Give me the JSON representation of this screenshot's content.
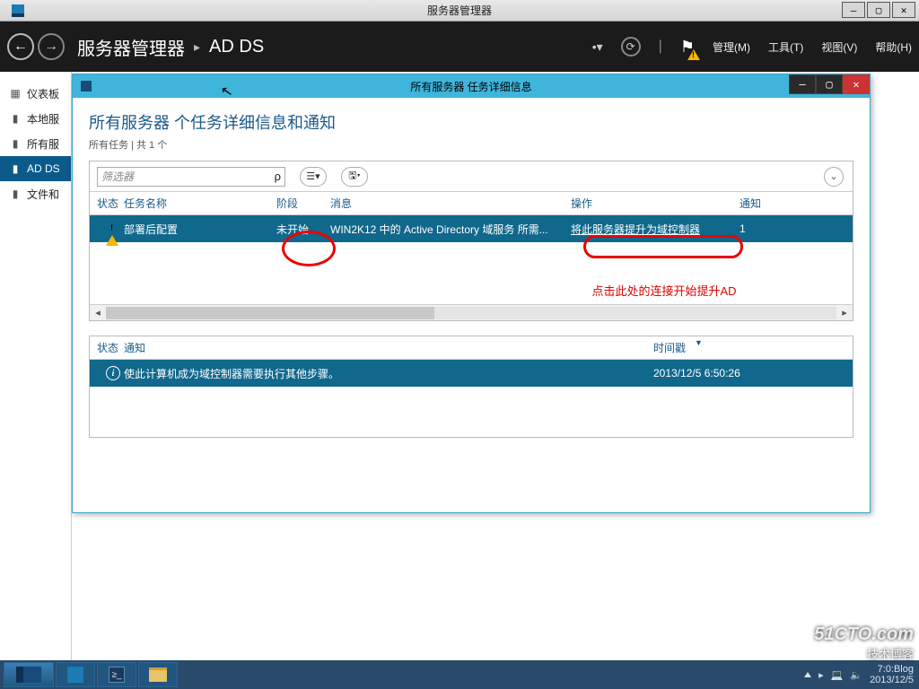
{
  "outer_window": {
    "title": "服务器管理器"
  },
  "header": {
    "breadcrumb_root": "服务器管理器",
    "breadcrumb_leaf": "AD DS",
    "menu_manage": "管理(M)",
    "menu_tools": "工具(T)",
    "menu_view": "视图(V)",
    "menu_help": "帮助(H)"
  },
  "sidebar": {
    "items": [
      {
        "icon": "▦",
        "label": "仪表板"
      },
      {
        "icon": "▮",
        "label": "本地服"
      },
      {
        "icon": "▮",
        "label": "所有服"
      },
      {
        "icon": "▮",
        "label": "AD DS"
      },
      {
        "icon": "▮",
        "label": "文件和"
      }
    ]
  },
  "dialog": {
    "title": "所有服务器 任务详细信息",
    "heading": "所有服务器 个任务详细信息和通知",
    "subcount": "所有任务 | 共 1 个",
    "filter_placeholder": "筛选器",
    "columns": {
      "status": "状态",
      "name": "任务名称",
      "stage": "阶段",
      "message": "消息",
      "action": "操作",
      "notify": "通知"
    },
    "row": {
      "name": "部署后配置",
      "stage": "未开始",
      "message": "WIN2K12 中的 Active Directory 域服务 所需...",
      "action": "将此服务器提升为域控制器",
      "notify": "1"
    },
    "annotation": "点击此处的连接开始提升AD",
    "columns2": {
      "status": "状态",
      "notify": "通知",
      "time": "时间戳"
    },
    "row2": {
      "notify": "使此计算机成为域控制器需要执行其他步骤。",
      "time": "2013/12/5 6:50:26"
    }
  },
  "taskbar": {
    "time": "7:0:Blog",
    "date": "2013/12/5"
  },
  "watermark": {
    "l1": "51CTO.com",
    "l2": "技术博客"
  }
}
